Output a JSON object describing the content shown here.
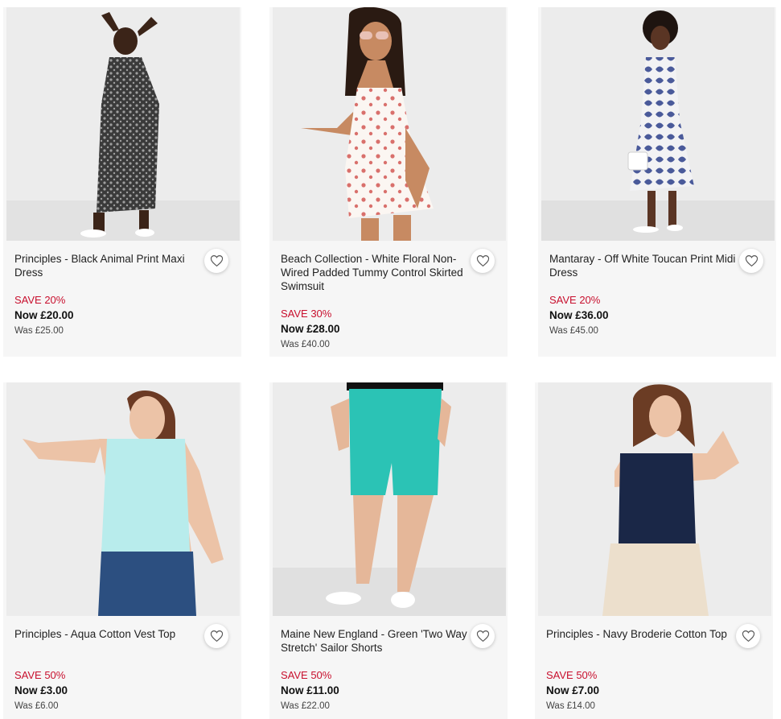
{
  "products": [
    {
      "title": "Principles - Black Animal Print Maxi Dress",
      "save": "SAVE 20%",
      "now": "Now £20.00",
      "was": "Was £25.00",
      "image": "woman-black-animal-print-maxi-dress",
      "wishlist_icon": "heart-outline-icon"
    },
    {
      "title": "Beach Collection - White Floral Non-Wired Padded Tummy Control Skirted Swimsuit",
      "save": "SAVE 30%",
      "now": "Now £28.00",
      "was": "Was £40.00",
      "image": "woman-white-floral-swimsuit",
      "wishlist_icon": "heart-outline-icon"
    },
    {
      "title": "Mantaray - Off White Toucan Print Midi Dress",
      "save": "SAVE 20%",
      "now": "Now £36.00",
      "was": "Was £45.00",
      "image": "woman-toucan-print-midi-dress",
      "wishlist_icon": "heart-outline-icon"
    },
    {
      "title": "Principles - Aqua Cotton Vest Top",
      "save": "SAVE 50%",
      "now": "Now £3.00",
      "was": "Was £6.00",
      "image": "woman-aqua-vest-top",
      "wishlist_icon": "heart-outline-icon"
    },
    {
      "title": "Maine New England - Green 'Two Way Stretch' Sailor Shorts",
      "save": "SAVE 50%",
      "now": "Now £11.00",
      "was": "Was £22.00",
      "image": "green-sailor-shorts",
      "wishlist_icon": "heart-outline-icon"
    },
    {
      "title": "Principles - Navy Broderie Cotton Top",
      "save": "SAVE 50%",
      "now": "Now £7.00",
      "was": "Was £14.00",
      "image": "woman-navy-broderie-top",
      "wishlist_icon": "heart-outline-icon"
    }
  ],
  "colors": {
    "sale_red": "#c8102e",
    "card_bg": "#f6f6f6",
    "image_bg": "#ececec"
  }
}
